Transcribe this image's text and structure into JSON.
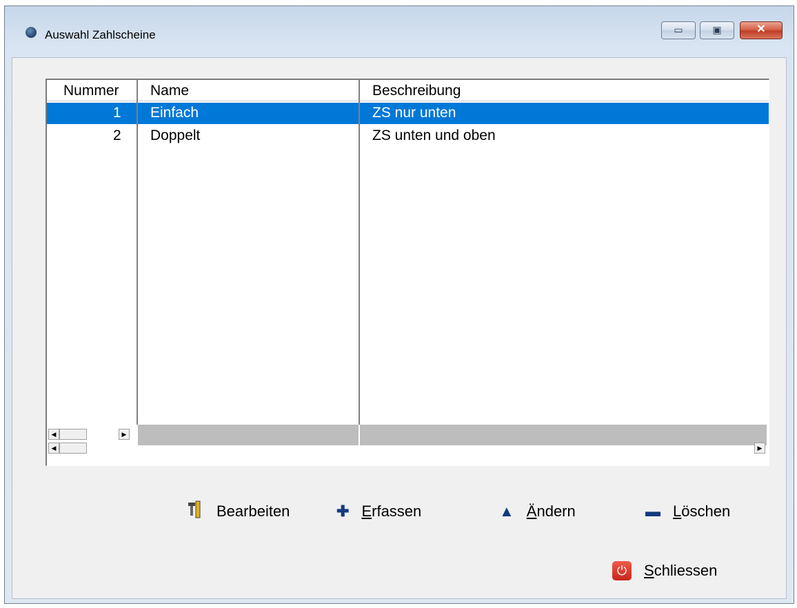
{
  "window": {
    "title": "Auswahl Zahlscheine"
  },
  "table": {
    "columns": [
      "Nummer",
      "Name",
      "Beschreibung"
    ],
    "rows": [
      {
        "nummer": "1",
        "name": "Einfach",
        "beschreibung": "ZS nur unten",
        "selected": true
      },
      {
        "nummer": "2",
        "name": "Doppelt",
        "beschreibung": "ZS unten und oben",
        "selected": false
      }
    ]
  },
  "buttons": {
    "bearbeiten": "Bearbeiten",
    "erfassen": "Erfassen",
    "aendern": "Ändern",
    "loeschen": "Löschen",
    "schliessen": "Schliessen"
  },
  "icons": {
    "app": "app-globe-icon",
    "bearbeiten": "tools-icon",
    "erfassen": "plus-icon",
    "aendern": "triangle-icon",
    "loeschen": "minus-icon",
    "schliessen": "power-icon"
  },
  "colors": {
    "selection": "#0078d7",
    "client_bg": "#f0f0f0",
    "close_button": "#c23c25"
  }
}
